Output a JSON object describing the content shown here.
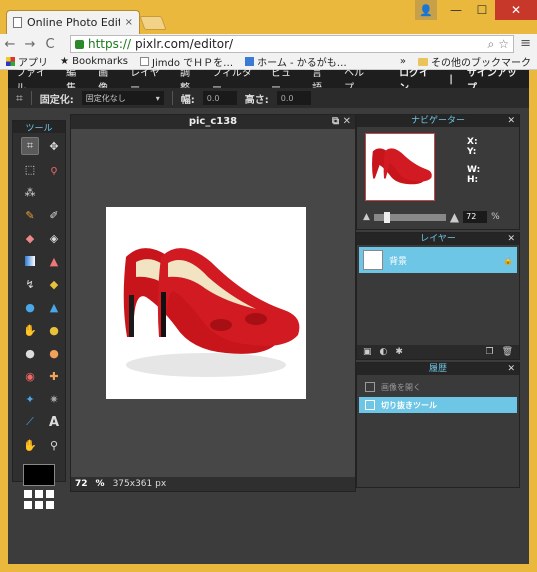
{
  "browser": {
    "tab_title": "Online Photo Editor",
    "tab_close": "×",
    "url_scheme": "https://",
    "url_rest": "pixlr.com/editor/",
    "window_user_glyph": "👤",
    "window_min": "—",
    "window_max": "☐",
    "window_close": "✕",
    "back": "←",
    "forward": "→",
    "reload": "C",
    "menu": "≡",
    "bookmarks": [
      {
        "label": "アプリ"
      },
      {
        "label": "★ Bookmarks"
      },
      {
        "label": "Jimdo でＨＰを…"
      },
      {
        "label": "ホーム - かるがも…"
      }
    ],
    "bookmarks_more": "»",
    "other_bookmarks": "その他のブックマーク"
  },
  "pixlr": {
    "menu": [
      "ファイル",
      "編集",
      "画像",
      "レイヤー",
      "調整",
      "フィルター",
      "ビュー",
      "言語",
      "ヘルプ"
    ],
    "login": "ログイン",
    "divider": "|",
    "signup": "サインアップ",
    "options": {
      "fixed_label": "固定化:",
      "fixed_value": "固定化なし",
      "width_label": "幅:",
      "width_value": "0.0",
      "height_label": "高さ:",
      "height_value": "0.0"
    },
    "tools_title": "ツール",
    "tool_glyph_A": "A",
    "canvas": {
      "title": "pic_c138",
      "zoom": "72",
      "percent": "%",
      "size": "375x361 px"
    },
    "navigator": {
      "title": "ナビゲーター",
      "x": "X:",
      "y": "Y:",
      "w": "W:",
      "h": "H:",
      "zoom": "72",
      "percent": "%"
    },
    "layers": {
      "title": "レイヤー",
      "items": [
        {
          "name": "背景"
        }
      ]
    },
    "history": {
      "title": "履歴",
      "items": [
        {
          "label": "画像を開く",
          "selected": false
        },
        {
          "label": "切り抜きツール",
          "selected": true
        }
      ]
    },
    "colors": {
      "accent": "#6ec6e6",
      "shoe_red": "#c8141b"
    }
  }
}
